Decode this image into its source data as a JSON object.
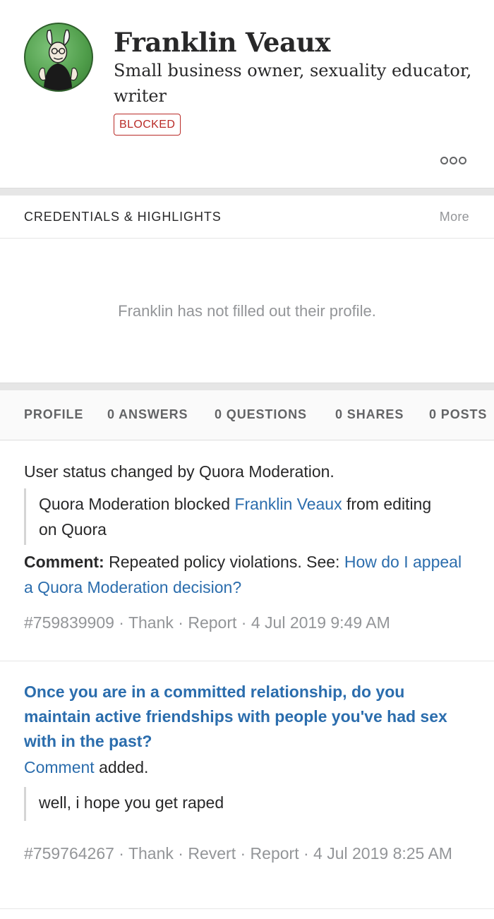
{
  "profile": {
    "name": "Franklin Veaux",
    "tagline": "Small business owner, sexuality educator, writer",
    "badge": "BLOCKED"
  },
  "credentials": {
    "title": "CREDENTIALS & HIGHLIGHTS",
    "more_label": "More",
    "empty_message": "Franklin has not filled out their profile."
  },
  "tabs": [
    {
      "label": "PROFILE"
    },
    {
      "label": "0 ANSWERS"
    },
    {
      "label": "0 QUESTIONS"
    },
    {
      "label": "0 SHARES"
    },
    {
      "label": "0 POSTS"
    }
  ],
  "feed": {
    "item1": {
      "status": "User status changed by Quora Moderation.",
      "quote_prefix": "Quora Moderation blocked ",
      "quote_link": "Franklin Veaux",
      "quote_suffix": " from editing on Quora",
      "comment_label": "Comment:",
      "comment_text": " Repeated policy violations. See: ",
      "comment_link": "How do I appeal a Quora Moderation decision?",
      "meta": {
        "id": "#759839909",
        "sep": " · ",
        "thank": "Thank",
        "report": "Report",
        "timestamp": "4 Jul 2019 9:49 AM"
      }
    },
    "item2": {
      "question": "Once you are in a committed relationship, do you maintain active friendships with people you've had sex with in the past?",
      "comment_link": "Comment",
      "comment_suffix": " added.",
      "quote": "well, i hope you get raped",
      "meta": {
        "id": "#759764267",
        "sep": " · ",
        "thank": "Thank",
        "revert": "Revert",
        "report": "Report",
        "timestamp": "4 Jul 2019 8:25 AM"
      }
    }
  },
  "colors": {
    "link": "#2b6dad",
    "blocked": "#b92b27",
    "muted": "#939598"
  }
}
